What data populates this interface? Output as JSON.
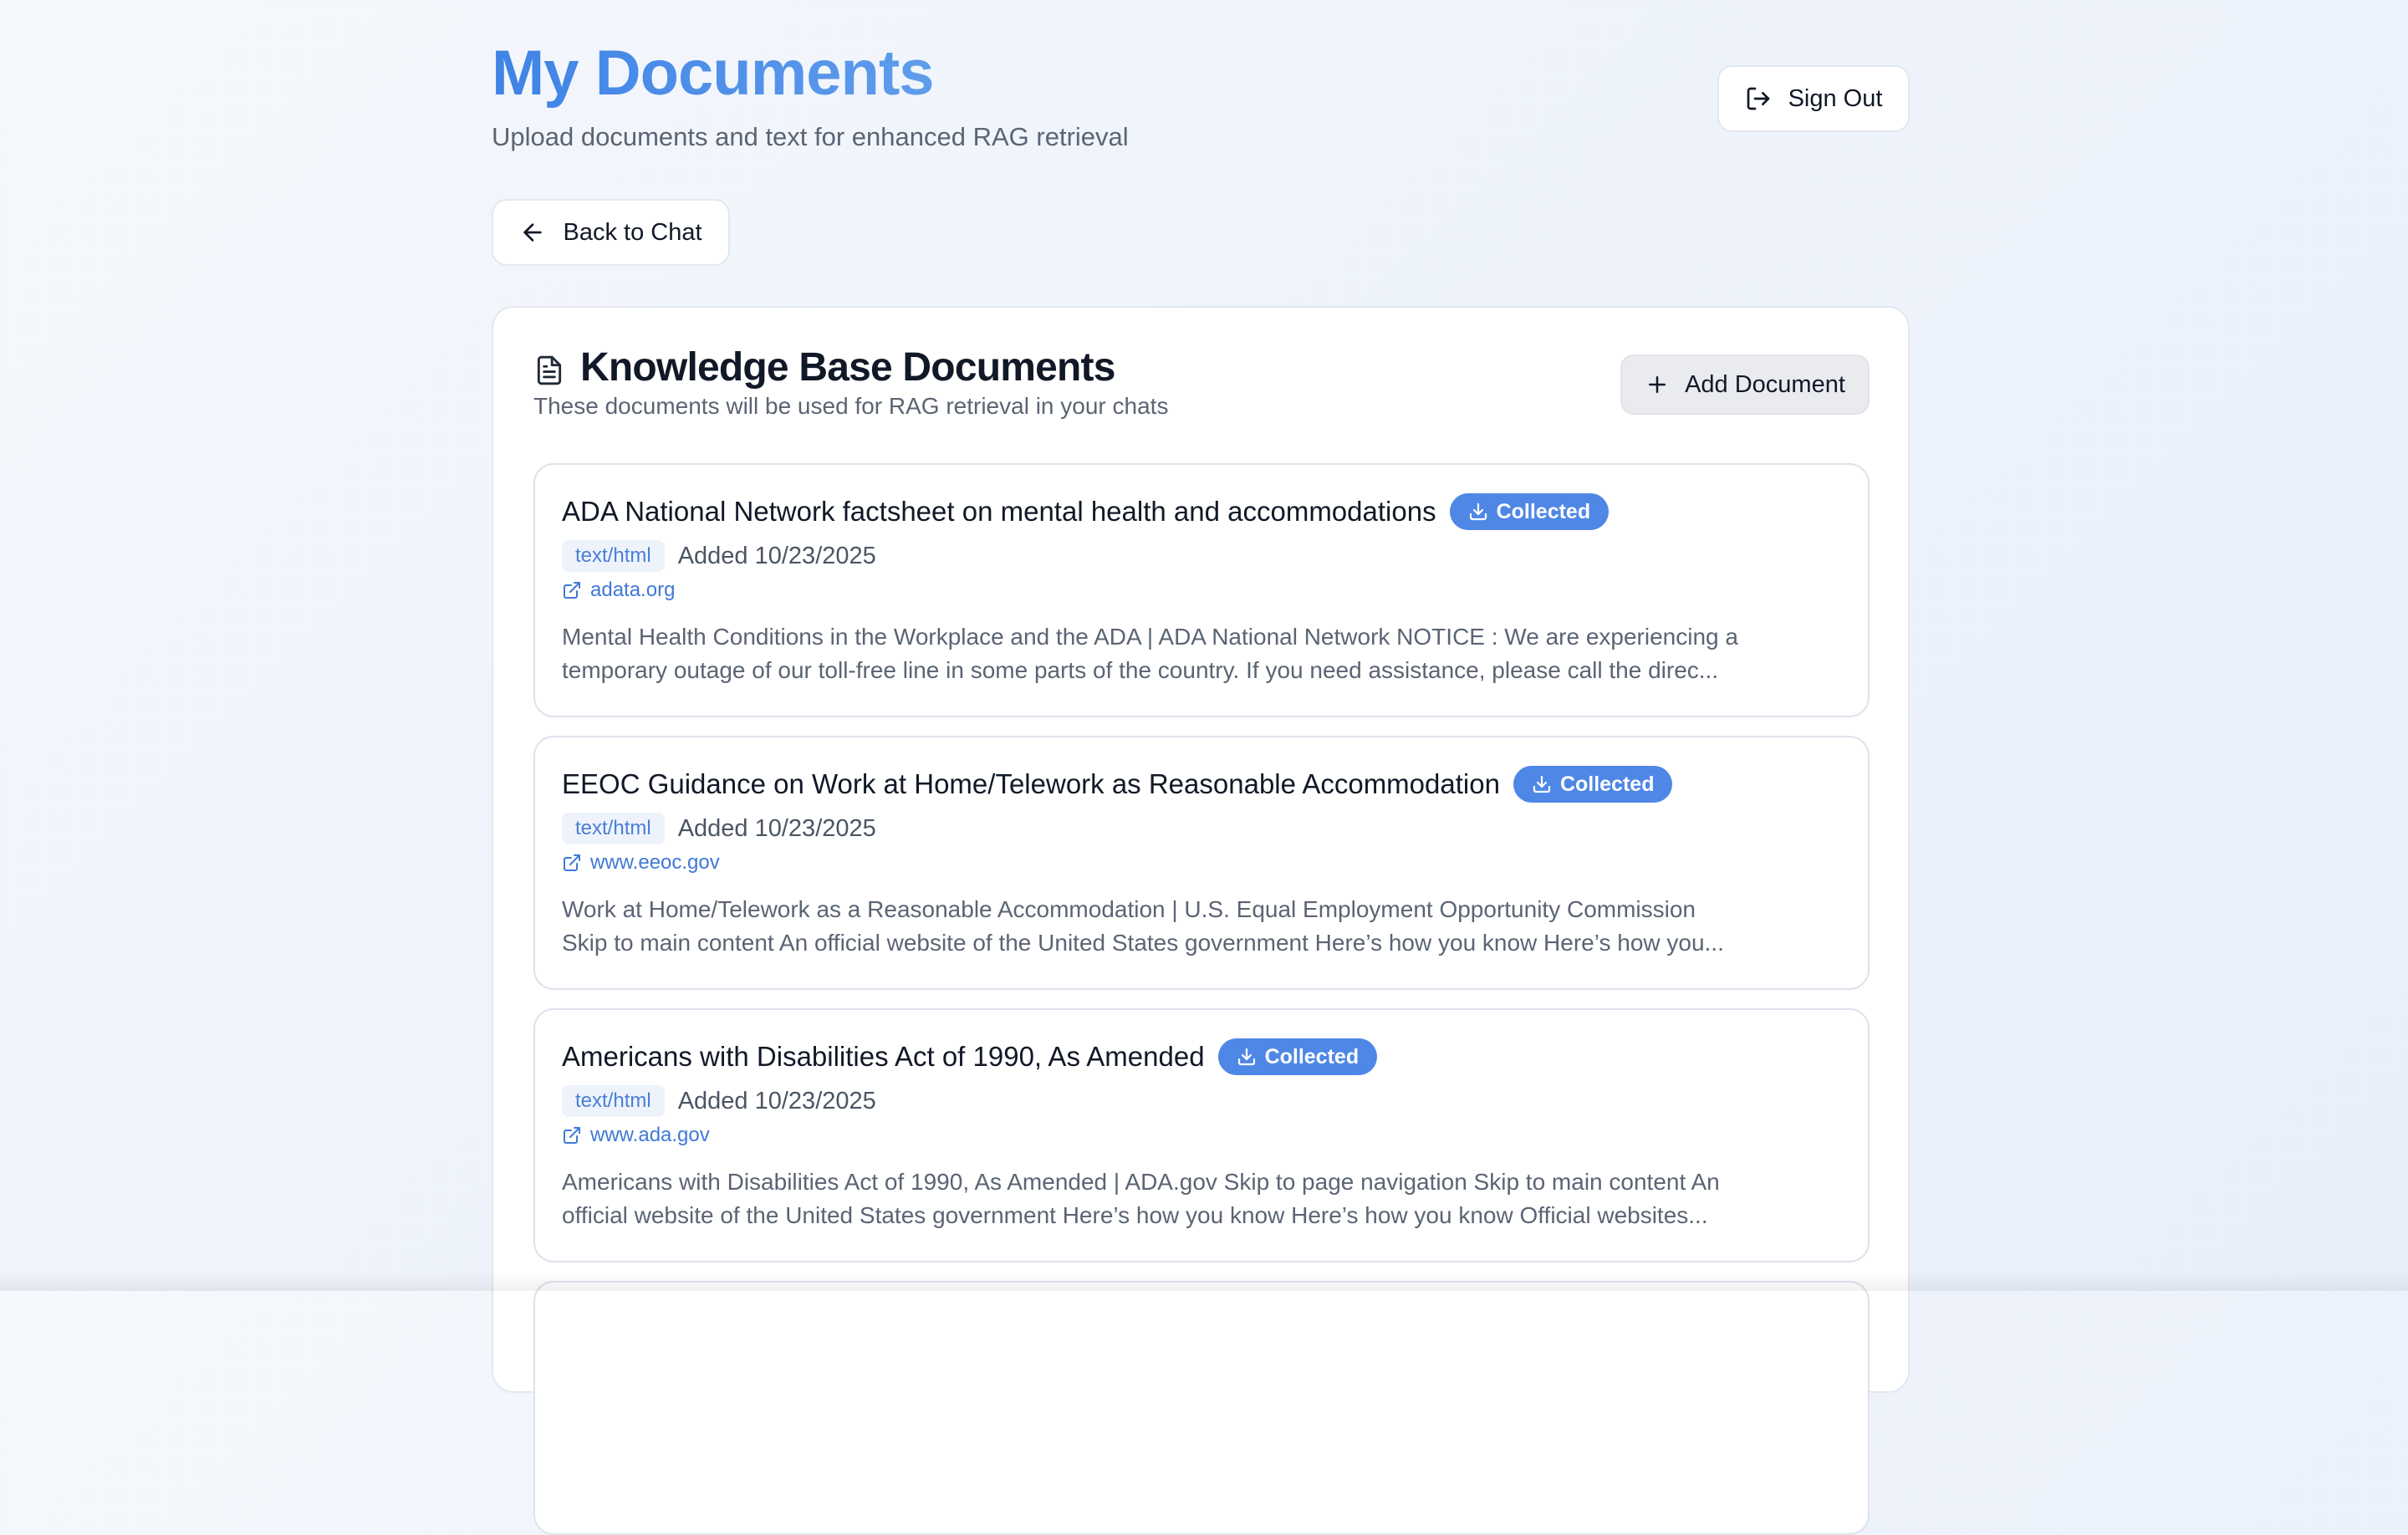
{
  "header": {
    "title": "My Documents",
    "subtitle": "Upload documents and text for enhanced RAG retrieval",
    "sign_out_label": "Sign Out",
    "back_label": "Back to Chat"
  },
  "panel": {
    "title": "Knowledge Base Documents",
    "description": "These documents will be used for RAG retrieval in your chats",
    "add_label": "Add Document"
  },
  "documents": [
    {
      "title": "ADA National Network factsheet on mental health and accommodations",
      "status": "Collected",
      "mime": "text/html",
      "added": "Added 10/23/2025",
      "domain": "adata.org",
      "excerpt_line1": "Mental Health Conditions in the Workplace and the ADA | ADA National Network NOTICE : We are experiencing a",
      "excerpt_line2": "temporary outage of our toll-free line in some parts of the country. If you need assistance, please call the direc..."
    },
    {
      "title": "EEOC Guidance on Work at Home/Telework as Reasonable Accommodation",
      "status": "Collected",
      "mime": "text/html",
      "added": "Added 10/23/2025",
      "domain": "www.eeoc.gov",
      "excerpt_line1": "Work at Home/Telework as a Reasonable Accommodation | U.S. Equal Employment Opportunity Commission",
      "excerpt_line2": "Skip to main content An official website of the United States government Here’s how you know Here’s how you..."
    },
    {
      "title": "Americans with Disabilities Act of 1990, As Amended",
      "status": "Collected",
      "mime": "text/html",
      "added": "Added 10/23/2025",
      "domain": "www.ada.gov",
      "excerpt_line1": "Americans with Disabilities Act of 1990, As Amended | ADA.gov Skip to page navigation Skip to main content An",
      "excerpt_line2": "official website of the United States government Here’s how you know Here’s how you know Official websites..."
    }
  ],
  "icons": {
    "sign_out": "sign-out-icon",
    "back": "arrow-left-icon",
    "panel": "document-icon",
    "add": "plus-icon",
    "collected": "download-icon",
    "external": "external-link-icon"
  },
  "colors": {
    "title_accent": "#4d8ae8",
    "badge_bg": "#4f87e6",
    "link": "#3f78d8",
    "mime_bg": "#eef3fb"
  }
}
